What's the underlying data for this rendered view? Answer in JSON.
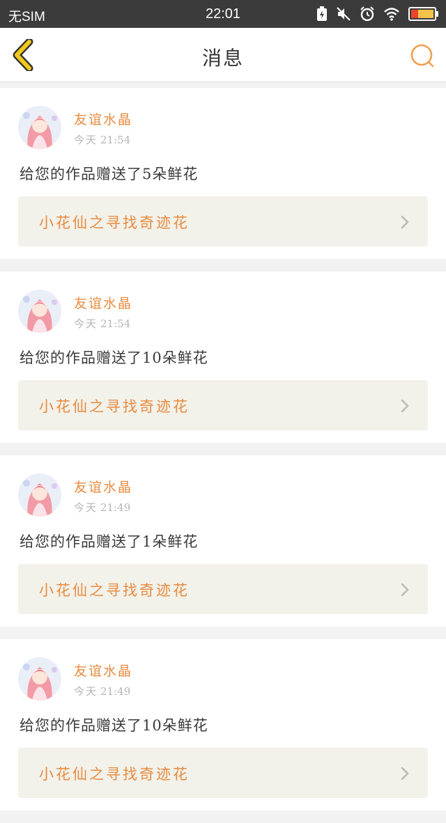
{
  "status": {
    "carrier": "无SIM",
    "time": "22:01"
  },
  "nav": {
    "title": "消息"
  },
  "messages": [
    {
      "sender": "友谊水晶",
      "day": "今天",
      "time": "21:54",
      "text": "给您的作品赠送了5朵鲜花",
      "work": "小花仙之寻找奇迹花"
    },
    {
      "sender": "友谊水晶",
      "day": "今天",
      "time": "21:54",
      "text": "给您的作品赠送了10朵鲜花",
      "work": "小花仙之寻找奇迹花"
    },
    {
      "sender": "友谊水晶",
      "day": "今天",
      "time": "21:49",
      "text": "给您的作品赠送了1朵鲜花",
      "work": "小花仙之寻找奇迹花"
    },
    {
      "sender": "友谊水晶",
      "day": "今天",
      "time": "21:49",
      "text": "给您的作品赠送了10朵鲜花",
      "work": "小花仙之寻找奇迹花"
    }
  ],
  "colors": {
    "accent": "#e88b3e",
    "back_arrow": "#f2c81a",
    "status_bar": "#3b3b3b"
  },
  "icons": {
    "back": "chevron-left-icon",
    "search": "search-icon",
    "link": "chevron-right-icon"
  }
}
